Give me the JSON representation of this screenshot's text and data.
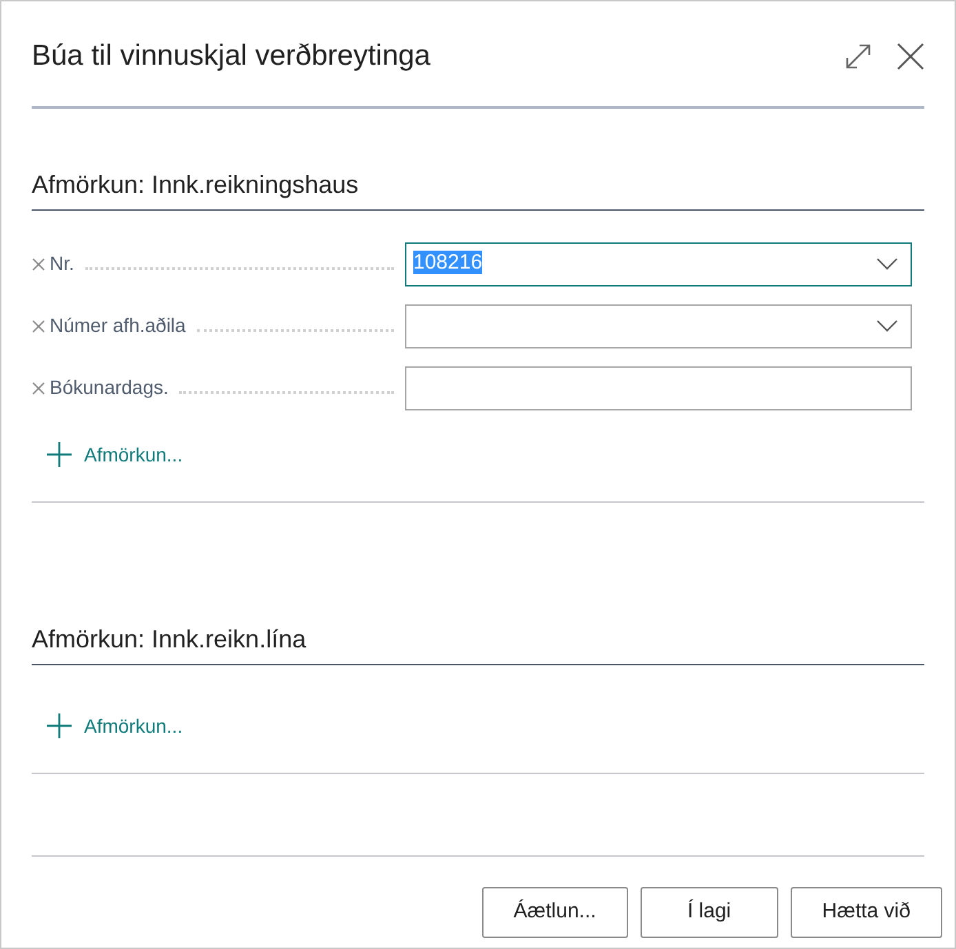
{
  "window": {
    "title": "Búa til vinnuskjal verðbreytinga"
  },
  "sections": [
    {
      "title": "Afmörkun: Innk.reikningshaus",
      "filters": [
        {
          "label": "Nr.",
          "kind": "dropdown",
          "value": "108216",
          "focused": true
        },
        {
          "label": "Númer afh.aðila",
          "kind": "dropdown",
          "focused": false
        },
        {
          "label": "Bókunardags.",
          "kind": "text",
          "focused": false
        }
      ],
      "add_filter": "Afmörkun..."
    },
    {
      "title": "Afmörkun: Innk.reikn.lína",
      "add_filter": "Afmörkun..."
    }
  ],
  "buttons": [
    "Áætlun...",
    "Í lagi",
    "Hætta við"
  ]
}
